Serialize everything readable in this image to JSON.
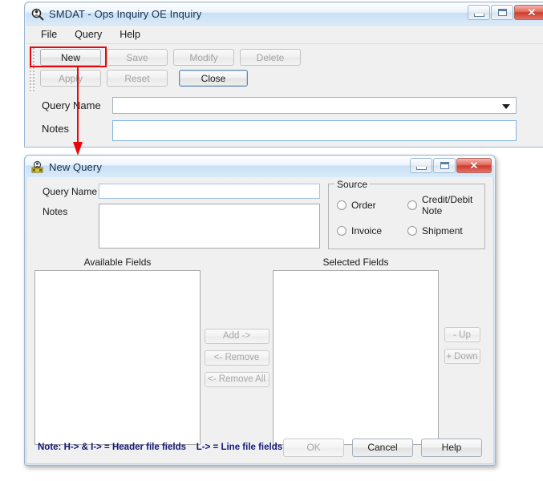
{
  "main_window": {
    "title": "SMDAT  - Ops Inquiry OE Inquiry",
    "icon": "magnifier-person-icon",
    "controls": {
      "minimize": "minimize-icon",
      "maximize": "maximize-icon",
      "close": "close-icon"
    },
    "menu": [
      "File",
      "Query",
      "Help"
    ],
    "toolbar_row1": [
      {
        "label": "New",
        "enabled": true,
        "highlighted": true
      },
      {
        "label": "Save",
        "enabled": false
      },
      {
        "label": "Modify",
        "enabled": false
      },
      {
        "label": "Delete",
        "enabled": false
      }
    ],
    "toolbar_row2": [
      {
        "label": "Apply",
        "enabled": false
      },
      {
        "label": "Reset",
        "enabled": false
      },
      {
        "label": "Close",
        "enabled": true,
        "default": true
      }
    ],
    "fields": {
      "query_name_label": "Query Name",
      "query_name_value": "",
      "notes_label": "Notes",
      "notes_value": ""
    }
  },
  "annotation": {
    "highlight_color": "#e8070c",
    "arrow_color": "#e8070c",
    "target": "New"
  },
  "dialog": {
    "title": "New Query",
    "icon": "new-query-icon",
    "controls": {
      "minimize": "minimize-icon",
      "maximize": "maximize-icon",
      "close": "close-icon"
    },
    "query_name_label": "Query Name",
    "query_name_value": "",
    "notes_label": "Notes",
    "notes_value": "",
    "source": {
      "legend": "Source",
      "options": [
        {
          "label": "Order",
          "selected": false
        },
        {
          "label": "Credit/Debit Note",
          "selected": false
        },
        {
          "label": "Invoice",
          "selected": false
        },
        {
          "label": "Shipment",
          "selected": false
        }
      ]
    },
    "available_fields_label": "Available Fields",
    "selected_fields_label": "Selected Fields",
    "available_fields": [],
    "selected_fields": [],
    "transfer_buttons": [
      {
        "label": "Add ->",
        "enabled": false
      },
      {
        "label": "<- Remove",
        "enabled": false
      },
      {
        "label": "<- Remove All",
        "enabled": false
      }
    ],
    "order_buttons": [
      {
        "label": "- Up",
        "enabled": false
      },
      {
        "label": "+ Down",
        "enabled": false
      }
    ],
    "note": "Note: H-> & I-> = Header file fields    L-> = Line file fields",
    "note_color": "#13197a",
    "footer_buttons": [
      {
        "label": "OK",
        "enabled": false
      },
      {
        "label": "Cancel",
        "enabled": true
      },
      {
        "label": "Help",
        "enabled": true
      }
    ]
  }
}
